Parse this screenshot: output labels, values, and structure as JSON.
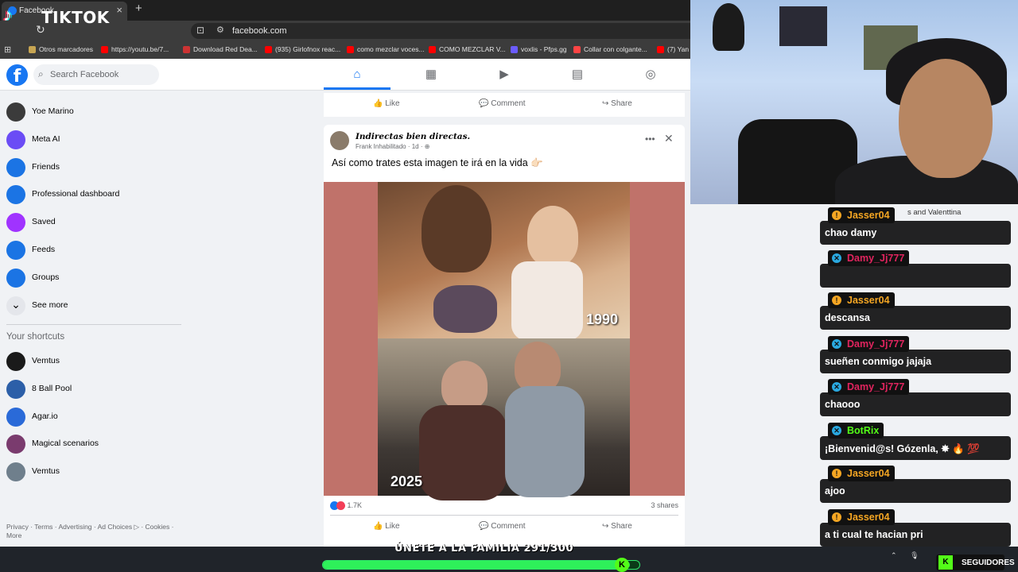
{
  "browser": {
    "tab_title": "Facebook",
    "url": "facebook.com",
    "bookmarks": [
      {
        "label": "Otros marcadores",
        "color": "#c7a552"
      },
      {
        "label": "https://youtu.be/7...",
        "color": "#ff0000"
      },
      {
        "label": "Download Red Dea...",
        "color": "#c33"
      },
      {
        "label": "(935) Girlofnox reac...",
        "color": "#ff0000"
      },
      {
        "label": "como mezclar voces...",
        "color": "#ff0000"
      },
      {
        "label": "COMO MEZCLAR V...",
        "color": "#ff0000"
      },
      {
        "label": "voxlis - Pfps.gg",
        "color": "#6b5cff"
      },
      {
        "label": "Collar con colgante...",
        "color": "#f44"
      },
      {
        "label": "(7) Yan Bl",
        "color": "#ff0000"
      }
    ]
  },
  "overlay": {
    "tiktok_label": "TIKTOK",
    "join_text": "ÚNETE A LA FAMILIA 291/300",
    "goal_current": 291,
    "goal_total": 300,
    "follow_label": "SEGUIDORES"
  },
  "facebook": {
    "search_placeholder": "Search Facebook",
    "nav_tabs": [
      {
        "icon": "home-icon",
        "glyph": "⌂"
      },
      {
        "icon": "dashboard-icon",
        "glyph": "▦"
      },
      {
        "icon": "video-icon",
        "glyph": "▶"
      },
      {
        "icon": "marketplace-icon",
        "glyph": "▤"
      },
      {
        "icon": "gaming-icon",
        "glyph": "◎"
      }
    ],
    "sidebar": [
      {
        "label": "Yoe Marino",
        "color": "#3b3b3b"
      },
      {
        "label": "Meta AI",
        "color": "#6b4cf5"
      },
      {
        "label": "Friends",
        "color": "#1b74e4"
      },
      {
        "label": "Professional dashboard",
        "color": "#1b74e4"
      },
      {
        "label": "Saved",
        "color": "#a033ff"
      },
      {
        "label": "Feeds",
        "color": "#1b74e4"
      },
      {
        "label": "Groups",
        "color": "#1b74e4"
      },
      {
        "label": "See more",
        "color": "#e4e6eb"
      }
    ],
    "shortcuts_title": "Your shortcuts",
    "shortcuts": [
      {
        "label": "Vemtus",
        "color": "#1a1a1a"
      },
      {
        "label": "8 Ball Pool",
        "color": "#2c5fa8"
      },
      {
        "label": "Agar.io",
        "color": "#2a6ad8"
      },
      {
        "label": "Magical scenarios",
        "color": "#7a3b6e"
      },
      {
        "label": "Vemtus",
        "color": "#6f7f8c"
      }
    ],
    "footer": "Privacy · Terms · Advertising · Ad Choices ▷ · Cookies · More",
    "actions": {
      "like": "Like",
      "comment": "Comment",
      "share": "Share"
    },
    "post": {
      "author": "Indirectas bien directas.",
      "meta": "Frank Inhabilitado · 1d · ⊕",
      "text": "Así como trates esta imagen te irá en la vida 👉🏻",
      "year_top": "1990",
      "year_bottom": "2025",
      "reactions": "1.7K",
      "shares": "3 shares"
    }
  },
  "chat": {
    "background_text": "s and Valenttina",
    "messages": [
      {
        "user": "Jasser04",
        "color": "#f5a623",
        "badge": "!",
        "badge_color": "#f5a623",
        "text": "chao damy"
      },
      {
        "user": "Damy_Jj777",
        "color": "#e0245e",
        "badge": "✕",
        "badge_color": "#2aa9e0",
        "text": ""
      },
      {
        "user": "Jasser04",
        "color": "#f5a623",
        "badge": "!",
        "badge_color": "#f5a623",
        "text": "descansa"
      },
      {
        "user": "Damy_Jj777",
        "color": "#e0245e",
        "badge": "✕",
        "badge_color": "#2aa9e0",
        "text": "sueñen conmigo jajaja"
      },
      {
        "user": "Damy_Jj777",
        "color": "#e0245e",
        "badge": "✕",
        "badge_color": "#2aa9e0",
        "text": "chaooo"
      },
      {
        "user": "BotRix",
        "color": "#53fc18",
        "badge": "✕",
        "badge_color": "#2aa9e0",
        "text": "¡Bienvenid@s! Gózenla, ✸ 🔥 💯"
      },
      {
        "user": "Jasser04",
        "color": "#f5a623",
        "badge": "!",
        "badge_color": "#f5a623",
        "text": "ajoo"
      },
      {
        "user": "Jasser04",
        "color": "#f5a623",
        "badge": "!",
        "badge_color": "#f5a623",
        "text": "a ti cual te hacian pri"
      }
    ]
  }
}
